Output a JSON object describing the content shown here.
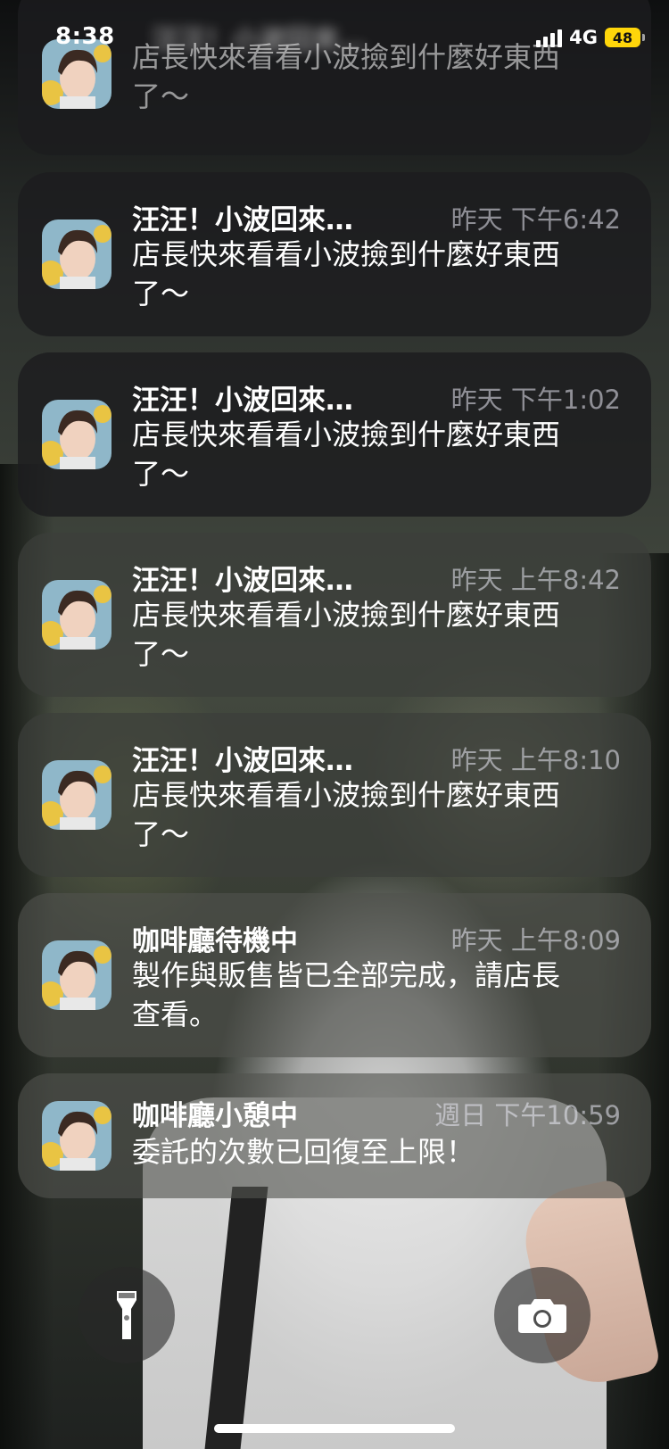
{
  "status_bar": {
    "time": "8:38",
    "network": "4G",
    "battery": "48"
  },
  "notifications": [
    {
      "title": "汪汪！小波回來…",
      "time": "",
      "body": "店長快來看看小波撿到什麼好東西了～"
    },
    {
      "title": "汪汪！小波回來…",
      "time": "昨天 下午6:42",
      "body": "店長快來看看小波撿到什麼好東西了～"
    },
    {
      "title": "汪汪！小波回來…",
      "time": "昨天 下午1:02",
      "body": "店長快來看看小波撿到什麼好東西了～"
    },
    {
      "title": "汪汪！小波回來…",
      "time": "昨天 上午8:42",
      "body": "店長快來看看小波撿到什麼好東西了～"
    },
    {
      "title": "汪汪！小波回來…",
      "time": "昨天 上午8:10",
      "body": "店長快來看看小波撿到什麼好東西了～"
    },
    {
      "title": "咖啡廳待機中",
      "time": "昨天 上午8:09",
      "body": "製作與販售皆已全部完成，請店長查看。"
    },
    {
      "title": "咖啡廳小憩中",
      "time": "週日 下午10:59",
      "body": "委託的次數已回復至上限！"
    }
  ],
  "controls": {
    "left_icon": "flashlight-icon",
    "right_icon": "camera-icon"
  }
}
